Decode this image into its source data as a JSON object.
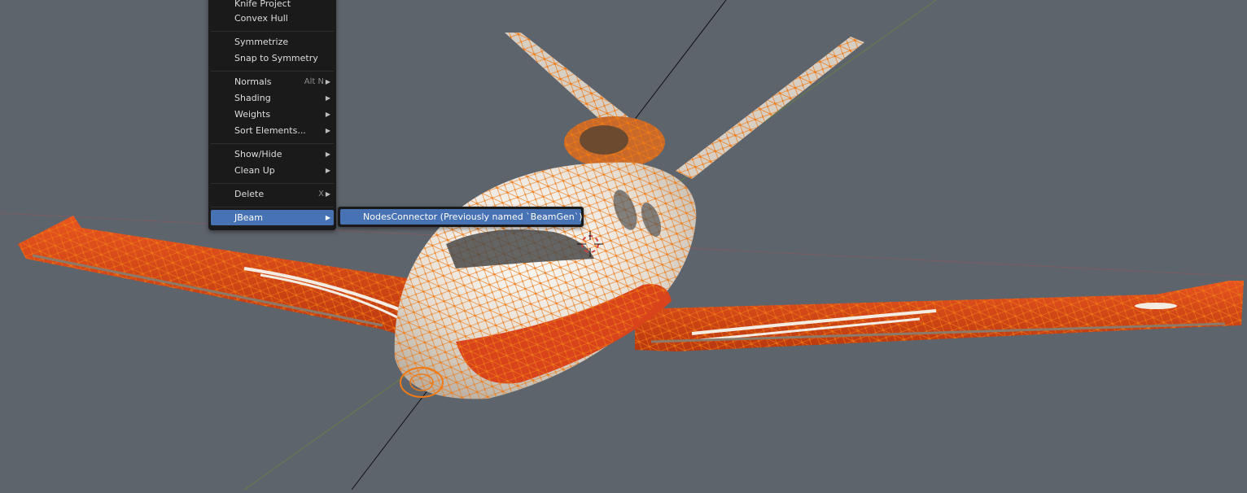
{
  "colors": {
    "viewport_bg": "#5e646c",
    "menu_bg": "#1a1a1a",
    "highlight": "#4772b3",
    "mesh_orange": "#f07a14",
    "body_white": "#e8e2d8",
    "paint_red": "#d9441c"
  },
  "menu": {
    "items": [
      {
        "label": "Knife Project"
      },
      {
        "label": "Convex Hull"
      },
      {
        "label": "Symmetrize"
      },
      {
        "label": "Snap to Symmetry"
      },
      {
        "label": "Normals",
        "shortcut": "Alt N",
        "has_submenu": true
      },
      {
        "label": "Shading",
        "has_submenu": true
      },
      {
        "label": "Weights",
        "has_submenu": true
      },
      {
        "label": "Sort Elements...",
        "has_submenu": true
      },
      {
        "label": "Show/Hide",
        "has_submenu": true
      },
      {
        "label": "Clean Up",
        "has_submenu": true
      },
      {
        "label": "Delete",
        "shortcut": "X",
        "has_submenu": true
      },
      {
        "label": "JBeam",
        "has_submenu": true,
        "active": true
      }
    ],
    "submenu_arrow": "▶"
  },
  "submenu": {
    "items": [
      {
        "label": "NodesConnector (Previously named `BeamGen`)"
      }
    ]
  },
  "viewport": {
    "object_description_icon": "3d-cursor-icon"
  }
}
